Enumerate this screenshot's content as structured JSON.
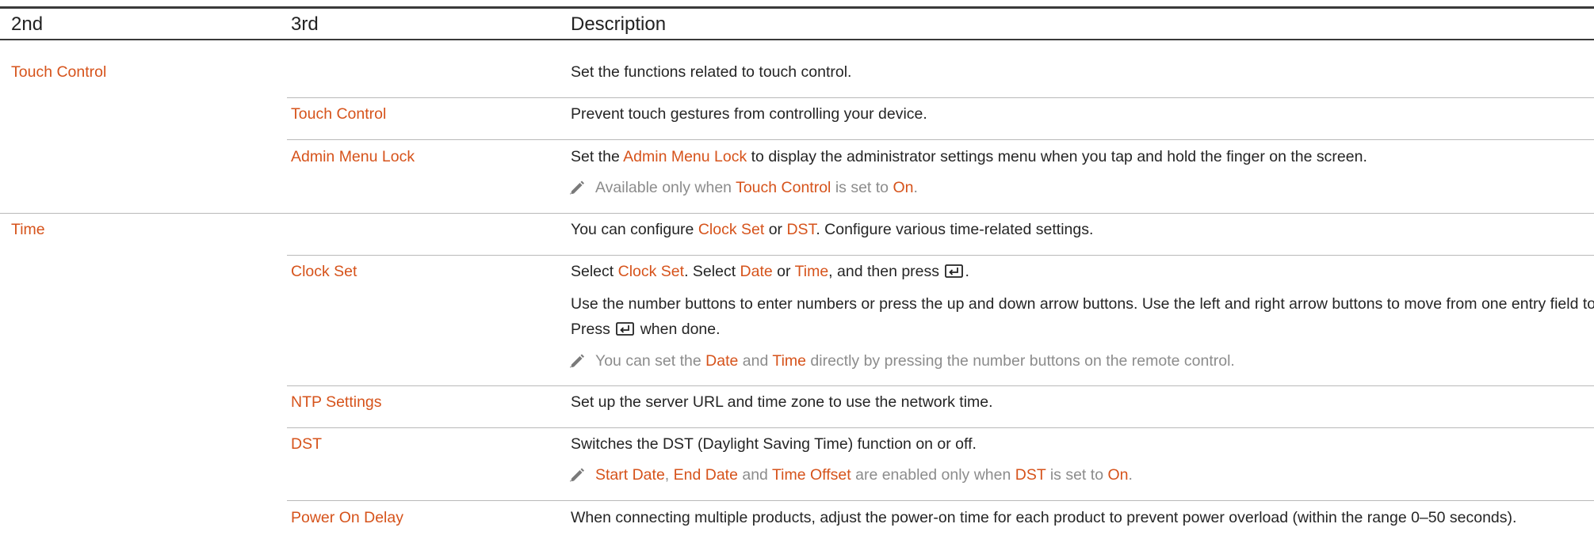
{
  "header": {
    "col_2nd": "2nd",
    "col_3rd": "3rd",
    "col_desc": "Description"
  },
  "touch_control": {
    "title": "Touch Control",
    "desc": "Set the functions related to touch control.",
    "sub_touch": {
      "title": "Touch Control",
      "desc": "Prevent touch gestures from controlling your device."
    },
    "sub_admin": {
      "title": "Admin Menu Lock",
      "desc_pre": "Set the ",
      "desc_link": "Admin Menu Lock",
      "desc_post": " to display the administrator settings menu when you tap and hold the finger on the screen.",
      "note_pre": "Available only when ",
      "note_link1": "Touch Control",
      "note_mid": " is set to ",
      "note_link2": "On",
      "note_end": "."
    }
  },
  "time": {
    "title": "Time",
    "desc_pre": "You can configure ",
    "desc_link1": "Clock Set",
    "desc_mid": " or ",
    "desc_link2": "DST",
    "desc_post": ". Configure various time-related settings.",
    "clock_set": {
      "title": "Clock Set",
      "line1_a": "Select ",
      "line1_link1": "Clock Set",
      "line1_b": ". Select ",
      "line1_link2": "Date",
      "line1_c": " or ",
      "line1_link3": "Time",
      "line1_d": ", and then press",
      "line1_e": ".",
      "para2_a": "Use the number buttons to enter numbers or press the up and down arrow buttons. Use the left and right arrow buttons to move from one entry field to the next. Press",
      "para2_b": "when done.",
      "note_a": "You can set the ",
      "note_link1": "Date",
      "note_b": " and ",
      "note_link2": "Time",
      "note_c": " directly by pressing the number buttons on the remote control."
    },
    "ntp": {
      "title": "NTP Settings",
      "desc": "Set up the server URL and time zone to use the network time."
    },
    "dst": {
      "title": "DST",
      "desc": "Switches the DST (Daylight Saving Time) function on or off.",
      "note_link1": "Start Date",
      "note_a": ", ",
      "note_link2": "End Date",
      "note_b": " and ",
      "note_link3": "Time Offset",
      "note_c": " are enabled only when ",
      "note_link4": "DST",
      "note_d": " is set to ",
      "note_link5": "On",
      "note_e": "."
    },
    "power_delay": {
      "title": "Power On Delay",
      "desc": "When connecting multiple products, adjust the power-on time for each product to prevent power overload (within the range 0–50 seconds)."
    }
  },
  "icons": {
    "note": "pencil-icon",
    "enter": "enter-key-icon"
  },
  "colors": {
    "link": "#d6531b",
    "note_text": "#8c8c8c",
    "rule": "#b9b9b9",
    "header_rule": "#3a3a3a"
  }
}
